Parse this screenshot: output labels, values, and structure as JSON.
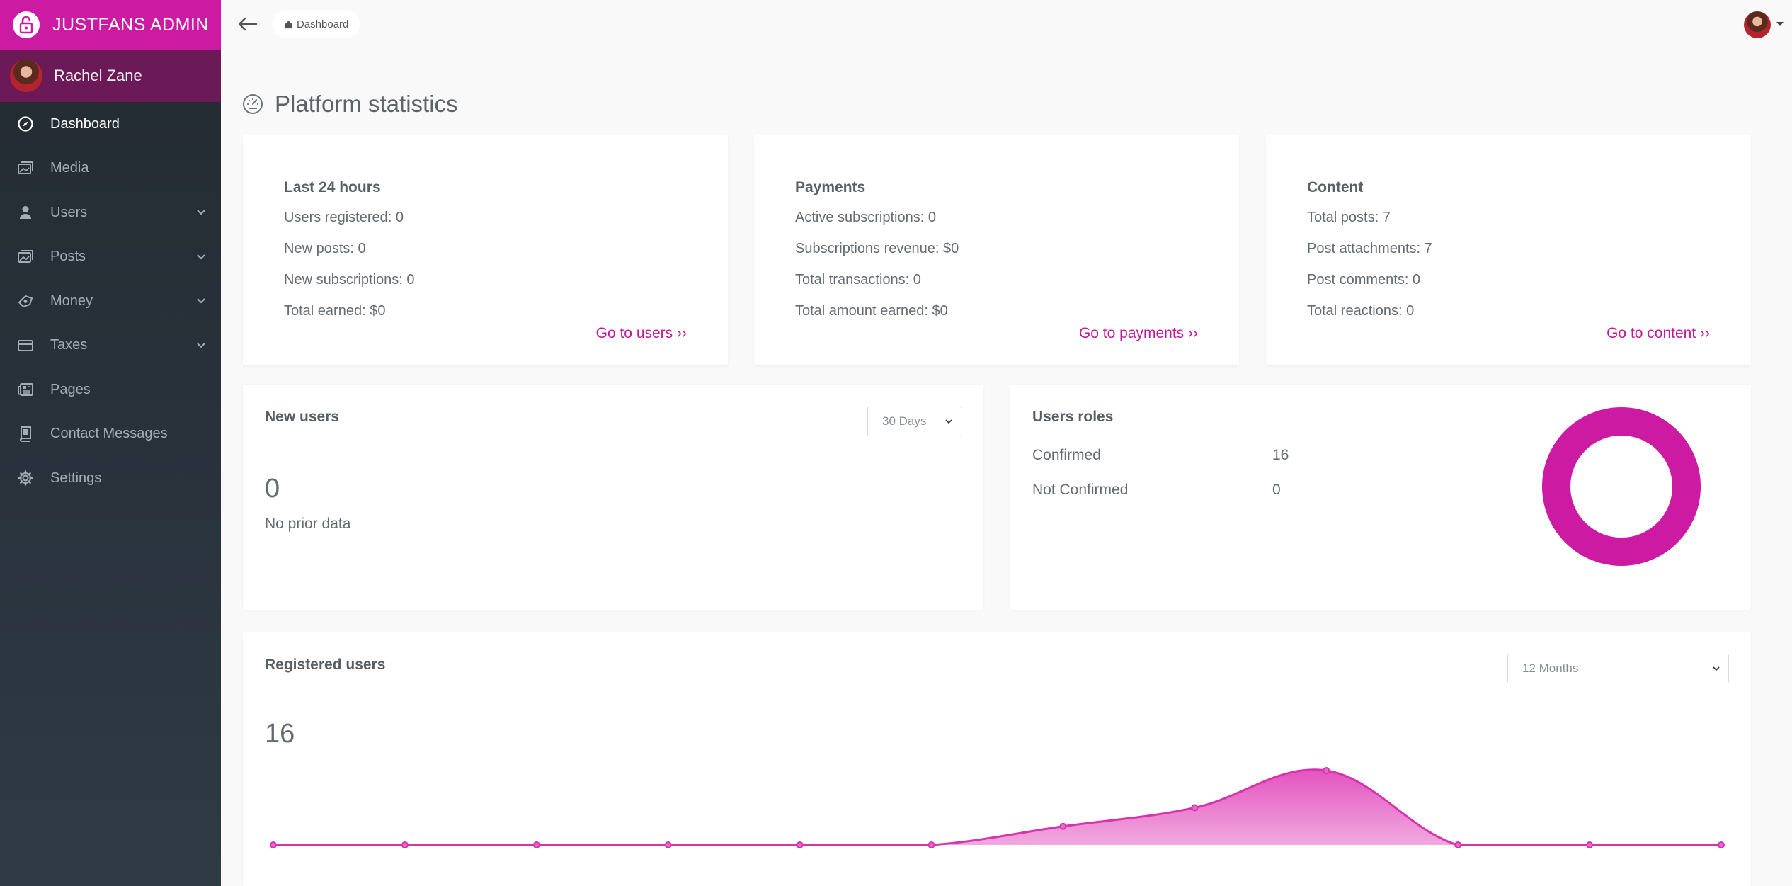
{
  "brand": {
    "title": "JUSTFANS ADMIN",
    "color": "#cc1aa3"
  },
  "profile": {
    "name": "Rachel Zane"
  },
  "sidebar": {
    "items": [
      {
        "label": "Dashboard",
        "icon": "compass-icon",
        "active": true,
        "expandable": false
      },
      {
        "label": "Media",
        "icon": "images-icon",
        "expandable": false
      },
      {
        "label": "Users",
        "icon": "user-icon",
        "expandable": true
      },
      {
        "label": "Posts",
        "icon": "images-icon",
        "expandable": true
      },
      {
        "label": "Money",
        "icon": "money-icon",
        "expandable": true
      },
      {
        "label": "Taxes",
        "icon": "credit-card-icon",
        "expandable": true
      },
      {
        "label": "Pages",
        "icon": "newspaper-icon",
        "expandable": false
      },
      {
        "label": "Contact Messages",
        "icon": "book-icon",
        "expandable": false
      },
      {
        "label": "Settings",
        "icon": "gear-icon",
        "expandable": false
      }
    ]
  },
  "topbar": {
    "breadcrumb": "Dashboard"
  },
  "page": {
    "title": "Platform statistics"
  },
  "cards": {
    "last24": {
      "title": "Last 24 hours",
      "rows": [
        "Users registered: 0",
        "New posts: 0",
        "New subscriptions: 0",
        "Total earned: $0"
      ],
      "link": "Go to users ››"
    },
    "payments": {
      "title": "Payments",
      "rows": [
        "Active subscriptions: 0",
        "Subscriptions revenue: $0",
        "Total transactions: 0",
        "Total amount earned: $0"
      ],
      "link": "Go to payments ››"
    },
    "content": {
      "title": "Content",
      "rows": [
        "Total posts: 7",
        "Post attachments: 7",
        "Post comments: 0",
        "Total reactions: 0"
      ],
      "link": "Go to content ››"
    }
  },
  "new_users": {
    "title": "New users",
    "range": "30 Days",
    "value": "0",
    "note": "No prior data"
  },
  "user_roles": {
    "title": "Users roles",
    "roles": [
      {
        "name": "Confirmed",
        "value": "16"
      },
      {
        "name": "Not Confirmed",
        "value": "0"
      }
    ],
    "color": "#cc1aa3"
  },
  "registered_users": {
    "title": "Registered users",
    "range": "12 Months",
    "value": "16"
  },
  "chart_data": {
    "type": "area",
    "x": [
      1,
      2,
      3,
      4,
      5,
      6,
      7,
      8,
      9,
      10,
      11,
      12
    ],
    "series": [
      {
        "values": [
          0,
          0,
          0,
          0,
          0,
          0,
          3,
          6,
          12,
          0,
          0,
          0
        ]
      }
    ],
    "ylim": [
      0,
      12
    ],
    "grid": false,
    "color": "#e040b8"
  }
}
